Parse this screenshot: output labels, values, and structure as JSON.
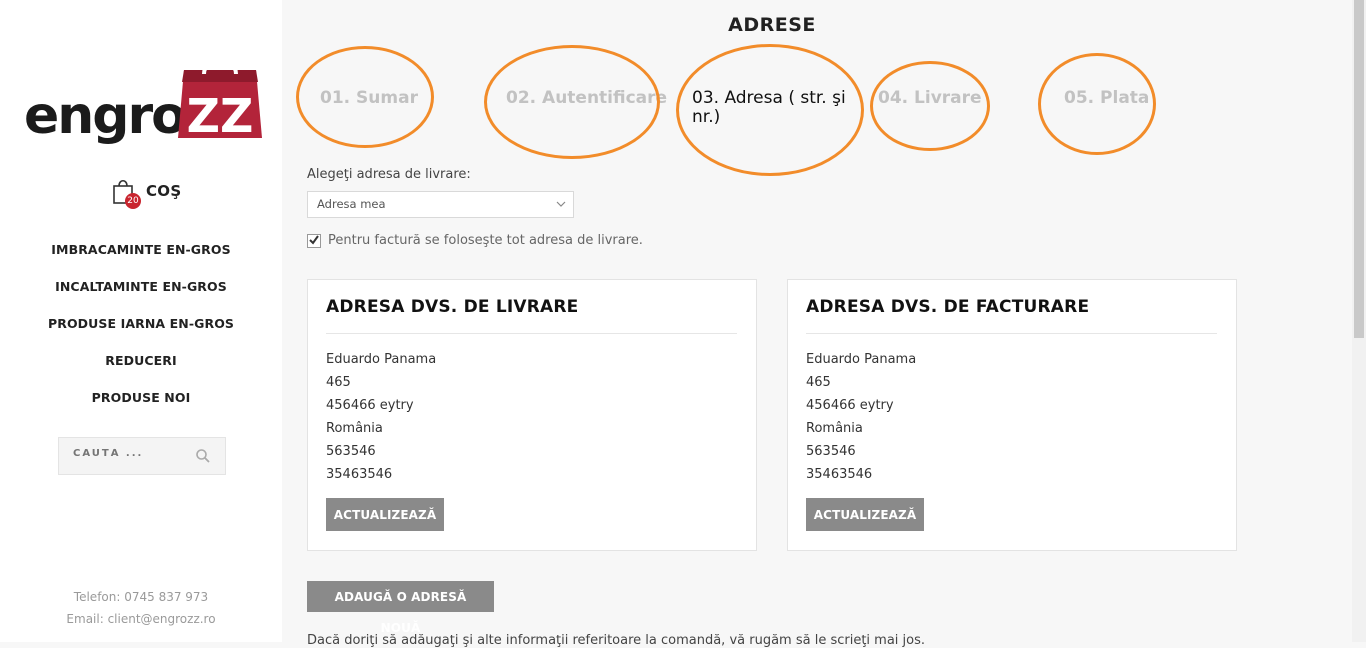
{
  "brand": {
    "logo_text": "engroZZ",
    "accent": "#b3243a"
  },
  "cart": {
    "count": "20",
    "label": "COŞ"
  },
  "nav": {
    "items": [
      "IMBRACAMINTE EN-GROS",
      "INCALTAMINTE EN-GROS",
      "PRODUSE IARNA EN-GROS",
      "REDUCERI",
      "PRODUSE NOI"
    ]
  },
  "search": {
    "placeholder": "CAUTĂ ..."
  },
  "contact": {
    "phone": "Telefon: 0745 837 973",
    "email": "Email: client@engrozz.ro"
  },
  "page": {
    "title": "ADRESE"
  },
  "steps": [
    {
      "label": "01. Sumar",
      "active": false
    },
    {
      "label": "02. Autentificare",
      "active": false
    },
    {
      "label": "03. Adresa ( str. şi nr.)",
      "active": true
    },
    {
      "label": "04. Livrare",
      "active": false
    },
    {
      "label": "05. Plata",
      "active": false
    }
  ],
  "address_select": {
    "label": "Alegeţi adresa de livrare:",
    "value": "Adresa mea"
  },
  "same_invoice": {
    "label": "Pentru factură se foloseşte tot adresa de livrare.",
    "checked": true
  },
  "delivery_card": {
    "title": "ADRESA DVS. DE LIVRARE",
    "lines": [
      "Eduardo Panama",
      "465",
      "456466 eytry",
      "România",
      "563546",
      "35463546"
    ],
    "button": "ACTUALIZEAZĂ"
  },
  "invoice_card": {
    "title": "ADRESA DVS. DE FACTURARE",
    "lines": [
      "Eduardo Panama",
      "465",
      "456466 eytry",
      "România",
      "563546",
      "35463546"
    ],
    "button": "ACTUALIZEAZĂ"
  },
  "add_address_button": "ADAUGĂ O ADRESĂ NOUĂ",
  "note": "Dacă doriţi să adăugaţi şi alte informaţii referitoare la comandă, vă rugăm să le scrieţi mai jos.",
  "annotation_color": "#f28c2a"
}
